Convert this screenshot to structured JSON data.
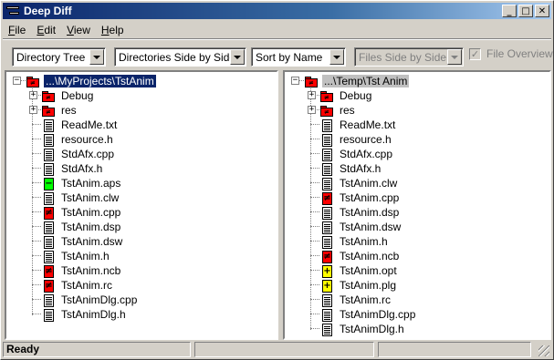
{
  "window": {
    "title": "Deep Diff",
    "controls": {
      "minimize": "_",
      "maximize": "□",
      "close": "✕"
    }
  },
  "menu": [
    {
      "label": "File",
      "accel": "F",
      "rest": "ile"
    },
    {
      "label": "Edit",
      "accel": "E",
      "rest": "dit"
    },
    {
      "label": "View",
      "accel": "V",
      "rest": "iew"
    },
    {
      "label": "Help",
      "accel": "H",
      "rest": "elp"
    }
  ],
  "toolbar": {
    "view_mode": "Directory Tree",
    "layout": "Directories Side by Side",
    "sort": "Sort by Name",
    "file_mode": "Files Side by Side",
    "file_overview_label": "File Overview",
    "file_overview_checked": true
  },
  "left_pane": {
    "root": "...\\MyProjects\\TstAnim",
    "items": [
      {
        "name": "Debug",
        "type": "folder",
        "status": "red",
        "expandable": true
      },
      {
        "name": "res",
        "type": "folder",
        "status": "red",
        "expandable": true
      },
      {
        "name": "ReadMe.txt",
        "type": "file",
        "status": "none"
      },
      {
        "name": "resource.h",
        "type": "file",
        "status": "none"
      },
      {
        "name": "StdAfx.cpp",
        "type": "file",
        "status": "none"
      },
      {
        "name": "StdAfx.h",
        "type": "file",
        "status": "none"
      },
      {
        "name": "TstAnim.aps",
        "type": "file",
        "status": "green",
        "mark": "−"
      },
      {
        "name": "TstAnim.clw",
        "type": "file",
        "status": "none"
      },
      {
        "name": "TstAnim.cpp",
        "type": "file",
        "status": "red",
        "mark": "≠"
      },
      {
        "name": "TstAnim.dsp",
        "type": "file",
        "status": "none"
      },
      {
        "name": "TstAnim.dsw",
        "type": "file",
        "status": "none"
      },
      {
        "name": "TstAnim.h",
        "type": "file",
        "status": "none"
      },
      {
        "name": "TstAnim.ncb",
        "type": "file",
        "status": "red",
        "mark": "≠"
      },
      {
        "name": "TstAnim.rc",
        "type": "file",
        "status": "red",
        "mark": "≠"
      },
      {
        "name": "TstAnimDlg.cpp",
        "type": "file",
        "status": "none"
      },
      {
        "name": "TstAnimDlg.h",
        "type": "file",
        "status": "none"
      }
    ]
  },
  "right_pane": {
    "root": "...\\Temp\\Tst Anim",
    "items": [
      {
        "name": "Debug",
        "type": "folder",
        "status": "red",
        "expandable": true
      },
      {
        "name": "res",
        "type": "folder",
        "status": "red",
        "expandable": true
      },
      {
        "name": "ReadMe.txt",
        "type": "file",
        "status": "none"
      },
      {
        "name": "resource.h",
        "type": "file",
        "status": "none"
      },
      {
        "name": "StdAfx.cpp",
        "type": "file",
        "status": "none"
      },
      {
        "name": "StdAfx.h",
        "type": "file",
        "status": "none"
      },
      {
        "name": "TstAnim.clw",
        "type": "file",
        "status": "none"
      },
      {
        "name": "TstAnim.cpp",
        "type": "file",
        "status": "red",
        "mark": "≠"
      },
      {
        "name": "TstAnim.dsp",
        "type": "file",
        "status": "none"
      },
      {
        "name": "TstAnim.dsw",
        "type": "file",
        "status": "none"
      },
      {
        "name": "TstAnim.h",
        "type": "file",
        "status": "none"
      },
      {
        "name": "TstAnim.ncb",
        "type": "file",
        "status": "red",
        "mark": "≠"
      },
      {
        "name": "TstAnim.opt",
        "type": "file",
        "status": "yellow",
        "mark": "+"
      },
      {
        "name": "TstAnim.plg",
        "type": "file",
        "status": "yellow",
        "mark": "+"
      },
      {
        "name": "TstAnim.rc",
        "type": "file",
        "status": "none"
      },
      {
        "name": "TstAnimDlg.cpp",
        "type": "file",
        "status": "none"
      },
      {
        "name": "TstAnimDlg.h",
        "type": "file",
        "status": "none"
      }
    ]
  },
  "status": {
    "text": "Ready"
  },
  "colors": {
    "changed": "#ff0000",
    "removed": "#00ff00",
    "added": "#ffff00",
    "selection": "#0a246a"
  }
}
